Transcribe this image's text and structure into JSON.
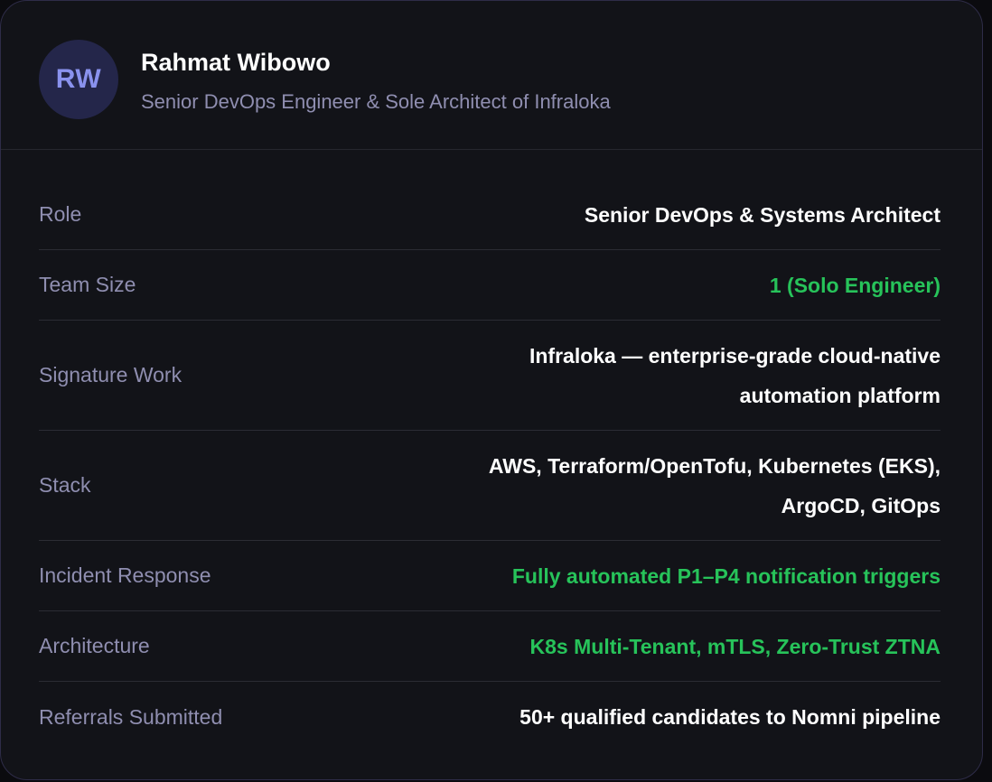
{
  "profile": {
    "initials": "RW",
    "name": "Rahmat Wibowo",
    "subtitle": "Senior DevOps Engineer & Sole Architect of Infraloka"
  },
  "details": [
    {
      "label": "Role",
      "value": "Senior DevOps & Systems Architect"
    },
    {
      "label": "Team Size",
      "value": "1 (Solo Engineer)"
    },
    {
      "label": "Signature Work",
      "value": "Infraloka — enterprise-grade cloud-native automation platform"
    },
    {
      "label": "Stack",
      "value": "AWS, Terraform/OpenTofu, Kubernetes (EKS), ArgoCD, GitOps"
    },
    {
      "label": "Incident Response",
      "value": "Fully automated P1–P4 notification triggers"
    },
    {
      "label": "Architecture",
      "value": "K8s Multi-Tenant, mTLS, Zero-Trust ZTNA"
    },
    {
      "label": "Referrals Submitted",
      "value": "50+ qualified candidates to Nomni pipeline"
    }
  ],
  "colors": {
    "highlight": "#27c35a",
    "label": "#8f8eb0",
    "avatar_text": "#8a92ee",
    "card_border": "#2e2c48"
  }
}
